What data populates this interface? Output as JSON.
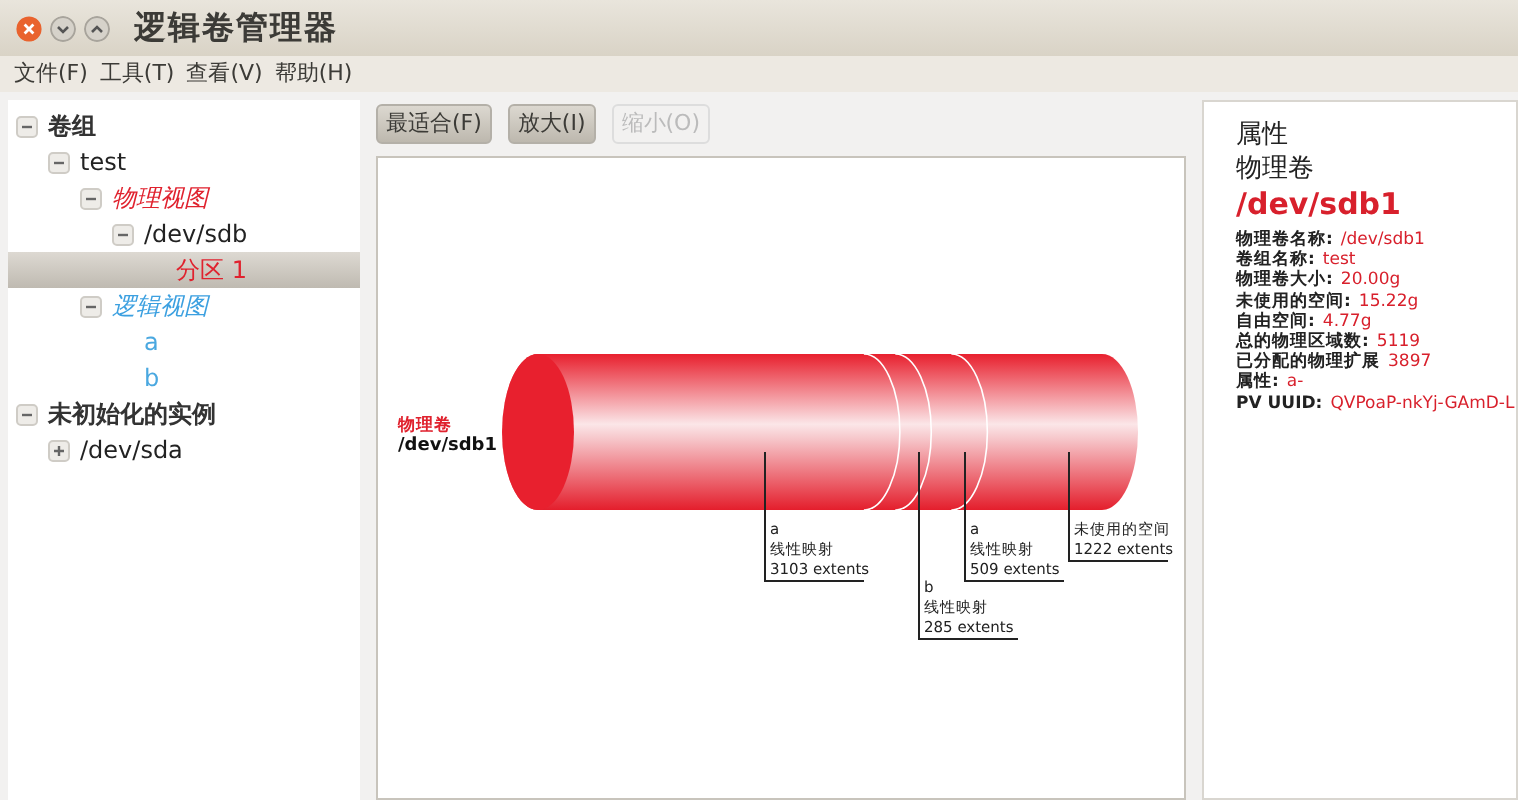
{
  "window": {
    "title": "逻辑卷管理器"
  },
  "menu": [
    "文件(F)",
    "工具(T)",
    "查看(V)",
    "帮助(H)"
  ],
  "tree": [
    {
      "label": "卷组",
      "kind": "heading",
      "expanded": true,
      "selected": false,
      "children": [
        {
          "label": "test",
          "kind": "item",
          "expanded": true,
          "selected": false,
          "children": [
            {
              "label": "物理视图",
              "kind": "physical",
              "expanded": true,
              "selected": false,
              "children": [
                {
                  "label": "/dev/sdb",
                  "kind": "item",
                  "expanded": true,
                  "selected": false,
                  "children": [
                    {
                      "label": "分区 1",
                      "kind": "partition",
                      "selected": true
                    }
                  ]
                }
              ]
            },
            {
              "label": "逻辑视图",
              "kind": "logical",
              "expanded": true,
              "selected": false,
              "children": [
                {
                  "label": "a",
                  "kind": "volume",
                  "selected": false
                },
                {
                  "label": "b",
                  "kind": "volume",
                  "selected": false
                }
              ]
            }
          ]
        }
      ]
    },
    {
      "label": "未初始化的实例",
      "kind": "heading",
      "expanded": true,
      "selected": false,
      "children": [
        {
          "label": "/dev/sda",
          "kind": "item",
          "expanded": false,
          "selected": false
        }
      ]
    }
  ],
  "toolbar": [
    {
      "label": "最适合(F)",
      "disabled": false
    },
    {
      "label": "放大(I)",
      "disabled": false
    },
    {
      "label": "缩小(O)",
      "disabled": true
    }
  ],
  "diagram": {
    "caption": "物理卷",
    "device": "/dev/sdb1",
    "segments": [
      {
        "name": "a",
        "mapping": "线性映射",
        "extents": "3103 extents",
        "kind": "used"
      },
      {
        "name": "b",
        "mapping": "线性映射",
        "extents": "285 extents",
        "kind": "used"
      },
      {
        "name": "a",
        "mapping": "线性映射",
        "extents": "509 extents",
        "kind": "used"
      },
      {
        "name": "未使用的空间",
        "extents": "1222 extents",
        "kind": "free"
      }
    ]
  },
  "properties": {
    "heading": "属性",
    "type": "物理卷",
    "name": "/dev/sdb1",
    "rows": [
      {
        "key": "物理卷名称:",
        "value": "/dev/sdb1"
      },
      {
        "key": "卷组名称:",
        "value": "test"
      },
      {
        "key": "物理卷大小:",
        "value": "20.00g"
      },
      {
        "key": "未使用的空间:",
        "value": "15.22g"
      },
      {
        "key": "自由空间:",
        "value": "4.77g"
      },
      {
        "key": "总的物理区域数:",
        "value": "5119"
      },
      {
        "key": "已分配的物理扩展",
        "value": "3897"
      },
      {
        "key": "属性:",
        "value": "a-"
      },
      {
        "key": "PV UUID:",
        "value": "QVPoaP-nkYj-GAmD-L"
      }
    ]
  }
}
